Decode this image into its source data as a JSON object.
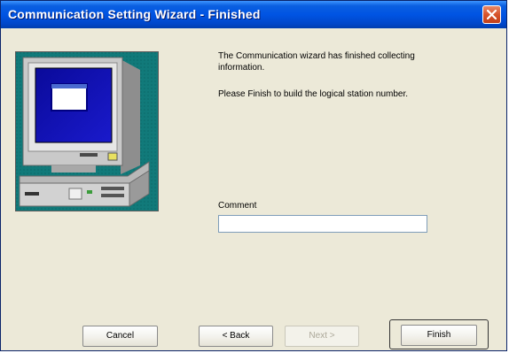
{
  "window": {
    "title": "Communication Setting Wizard - Finished"
  },
  "message": {
    "line1": "The Communication wizard has finished collecting information.",
    "line2": "Please Finish to build the logical station number."
  },
  "comment": {
    "label": "Comment",
    "value": ""
  },
  "buttons": {
    "cancel": "Cancel",
    "back": "< Back",
    "next": "Next >",
    "finish": "Finish"
  },
  "colors": {
    "titlebar": "#0054e3",
    "dialog_bg": "#ece9d8",
    "illustration_bg": "#0f7c7c",
    "close_button": "#d6532b"
  }
}
